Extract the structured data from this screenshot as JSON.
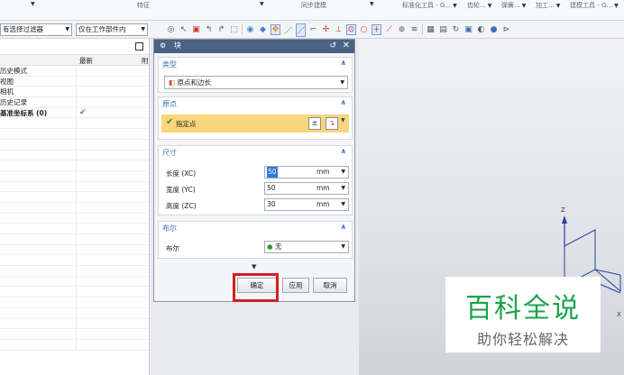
{
  "ribbon": {
    "group_feature": "特征",
    "group_sync": "同步建模",
    "group_std": "标准化工具 - G...",
    "group_gear": "齿轮...",
    "group_spring": "弹簧...",
    "group_machining": "加工...",
    "group_build": "建模工具 - G..."
  },
  "filterbar": {
    "filter_select": "有选择过滤器",
    "scope_select": "仅在工作部件内"
  },
  "navigator": {
    "col_latest": "最新",
    "col_third": "附",
    "rows": [
      {
        "label": "历史模式",
        "check": ""
      },
      {
        "label": "视图",
        "check": ""
      },
      {
        "label": "相机",
        "check": ""
      },
      {
        "label": "历史记录",
        "check": ""
      },
      {
        "label": "基准坐标系 (0)",
        "check": "✔"
      }
    ]
  },
  "dialog": {
    "title": "块",
    "sections": {
      "type": {
        "title": "类型",
        "value": "原点和边长"
      },
      "origin": {
        "title": "原点",
        "point_label": "指定点"
      },
      "dimensions": {
        "title": "尺寸",
        "rows": [
          {
            "label": "长度 (XC)",
            "value": "50",
            "unit": "mm"
          },
          {
            "label": "宽度 (YC)",
            "value": "50",
            "unit": "mm"
          },
          {
            "label": "高度 (ZC)",
            "value": "30",
            "unit": "mm"
          }
        ]
      },
      "boolean": {
        "title": "布尔",
        "label": "布尔",
        "value": "无"
      }
    },
    "buttons": {
      "ok": "确定",
      "apply": "应用",
      "cancel": "取消"
    }
  },
  "viewport": {
    "axis_z": "Z",
    "axis_x": "X"
  },
  "watermark": {
    "title": "百科全说",
    "subtitle": "助你轻松解决"
  },
  "colors": {
    "title_bar": "#4a6283",
    "section_title": "#3d6fb8",
    "point_highlight": "#f9d67c",
    "ok_highlight": "#d11f25",
    "watermark_green": "#1aa34a"
  }
}
